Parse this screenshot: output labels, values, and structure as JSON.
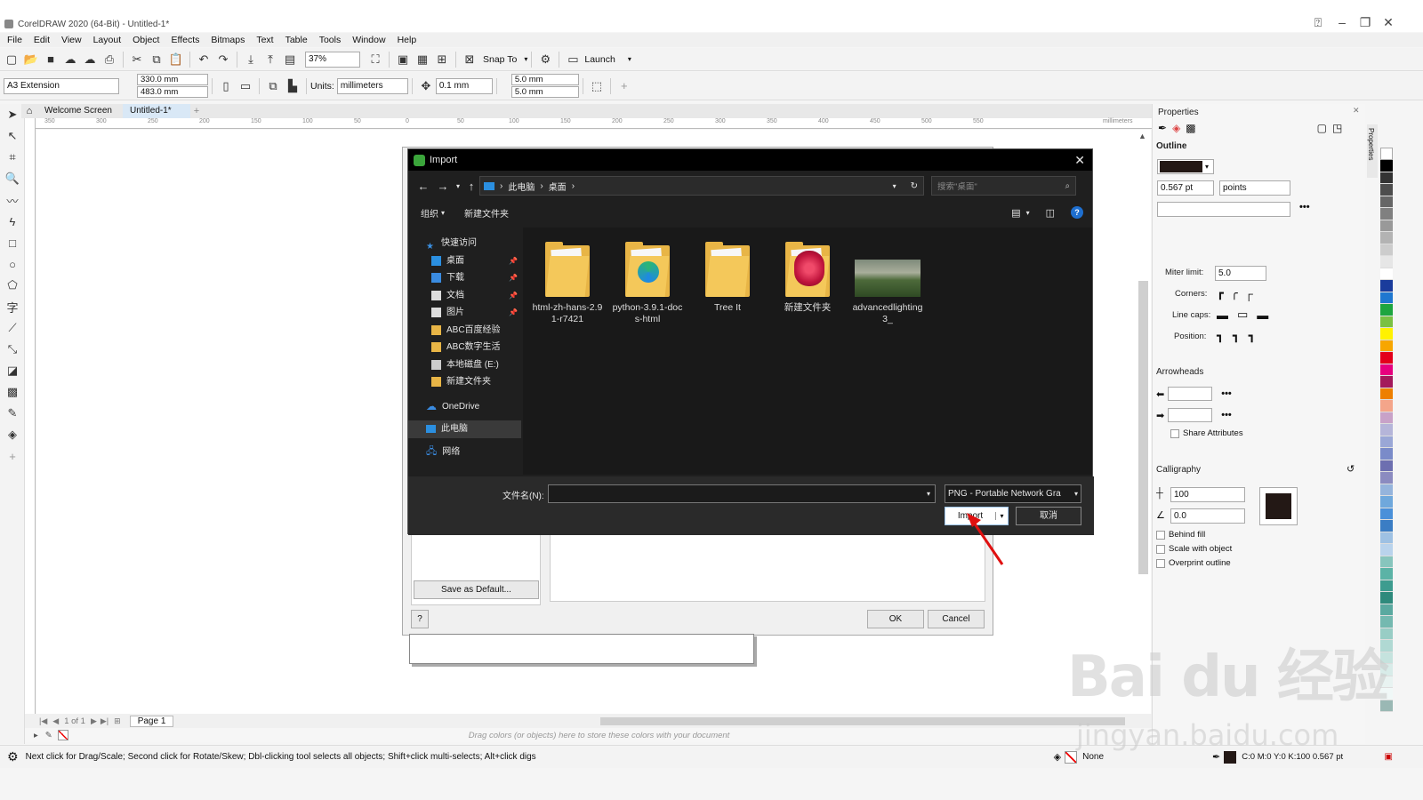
{
  "window": {
    "title": "CorelDRAW 2020 (64-Bit) - Untitled-1*"
  },
  "menu": [
    "File",
    "Edit",
    "View",
    "Layout",
    "Object",
    "Effects",
    "Bitmaps",
    "Text",
    "Table",
    "Tools",
    "Window",
    "Help"
  ],
  "toolbar1": {
    "zoom": "37%",
    "snap_to": "Snap To",
    "launch": "Launch"
  },
  "toolbar2": {
    "page_size": "A3 Extension",
    "width": "330.0 mm",
    "height": "483.0 mm",
    "units_label": "Units:",
    "units": "millimeters",
    "nudge": "0.1 mm",
    "dup_x": "5.0 mm",
    "dup_y": "5.0 mm"
  },
  "tabs": {
    "welcome": "Welcome Screen",
    "doc": "Untitled-1*"
  },
  "ruler": {
    "ticks": [
      "350",
      "300",
      "250",
      "200",
      "150",
      "100",
      "50",
      "0",
      "50",
      "100",
      "150",
      "200",
      "250",
      "300",
      "350",
      "400",
      "450",
      "500",
      "550"
    ],
    "unit": "millimeters"
  },
  "import_dialog": {
    "title": "Import",
    "breadcrumb": [
      "此电脑",
      "桌面"
    ],
    "search_placeholder": "搜索\"桌面\"",
    "organize": "组织",
    "new_folder": "新建文件夹",
    "tree": [
      {
        "label": "快速访问",
        "icon": "star-icon",
        "color": "#3b8fe0",
        "pin": false,
        "indent": 0
      },
      {
        "label": "桌面",
        "icon": "desktop-icon",
        "color": "#2b8fe0",
        "pin": true,
        "indent": 1
      },
      {
        "label": "下载",
        "icon": "download-icon",
        "color": "#3a8be0",
        "pin": true,
        "indent": 1
      },
      {
        "label": "文档",
        "icon": "document-icon",
        "color": "#dddddd",
        "pin": true,
        "indent": 1
      },
      {
        "label": "图片",
        "icon": "picture-icon",
        "color": "#dddddd",
        "pin": true,
        "indent": 1
      },
      {
        "label": "ABC百度经验",
        "icon": "folder-icon",
        "color": "#e8b546",
        "pin": false,
        "indent": 1
      },
      {
        "label": "ABC数字生活",
        "icon": "folder-icon",
        "color": "#e8b546",
        "pin": false,
        "indent": 1
      },
      {
        "label": "本地磁盘 (E:)",
        "icon": "drive-icon",
        "color": "#cccccc",
        "pin": false,
        "indent": 1
      },
      {
        "label": "新建文件夹",
        "icon": "folder-icon",
        "color": "#e8b546",
        "pin": false,
        "indent": 1
      }
    ],
    "onedrive": "OneDrive",
    "this_pc": "此电脑",
    "network": "网络",
    "files": [
      {
        "name": "html-zh-hans-2.91-r7421",
        "kind": "folder"
      },
      {
        "name": "python-3.9.1-docs-html",
        "kind": "folder-edge"
      },
      {
        "name": "Tree It",
        "kind": "folder"
      },
      {
        "name": "新建文件夹",
        "kind": "folder-flower"
      },
      {
        "name": "advancedlighting3_",
        "kind": "image"
      }
    ],
    "filename_label": "文件名(N):",
    "filename_value": "",
    "filetype": "PNG - Portable Network Gra",
    "import_btn": "Import",
    "cancel_btn": "取消"
  },
  "options_dialog": {
    "save_default": "Save as Default...",
    "help": "?",
    "ok": "OK",
    "cancel": "Cancel"
  },
  "properties": {
    "title": "Properties",
    "section": "Outline",
    "width_value": "0.567 pt",
    "width_unit": "points",
    "miter_label": "Miter limit:",
    "miter_value": "5.0",
    "corners_label": "Corners:",
    "linecaps_label": "Line caps:",
    "position_label": "Position:",
    "arrowheads": "Arrowheads",
    "share_attributes": "Share Attributes",
    "calligraphy": "Calligraphy",
    "stretch": "100",
    "angle": "0.0",
    "behind_fill": "Behind fill",
    "scale_with_object": "Scale with object",
    "overprint_outline": "Overprint outline",
    "side_tab": "Properties"
  },
  "palette": [
    "#000000",
    "#333333",
    "#4d4d4d",
    "#666666",
    "#808080",
    "#999999",
    "#b3b3b3",
    "#cccccc",
    "#e6e6e6",
    "#ffffff",
    "#1a3c9c",
    "#1f77d0",
    "#1da53f",
    "#7ac143",
    "#fff200",
    "#f7a600",
    "#e3001b",
    "#e6007e",
    "#a3195b",
    "#ee7f00",
    "#f4a58a",
    "#c8a2c8",
    "#b5b5d9",
    "#9aa7d6",
    "#7a8bc9",
    "#6d6fb0",
    "#8b8bc0",
    "#95b4dc",
    "#6fa8dc",
    "#4a90d9",
    "#3b7dc4",
    "#9ec1e3",
    "#b9d3ec",
    "#87c5bd",
    "#5bb3a6",
    "#3d9c8f",
    "#2e8a7c",
    "#5aa9a0",
    "#74b9b0",
    "#98cdc5",
    "#b0d9d3",
    "#c5e3de",
    "#d8ece9",
    "#e8f3f1",
    "#f0f8f7",
    "#9ab8b4"
  ],
  "docbar": {
    "page_info": "1 of 1",
    "page_tab": "Page 1"
  },
  "dropbar": {
    "hint": "Drag colors (or objects) here to store these colors with your document"
  },
  "status": {
    "hint": "Next click for Drag/Scale; Second click for Rotate/Skew; Dbl-clicking tool selects all objects; Shift+click multi-selects; Alt+click digs",
    "fill": "None",
    "outline": "C:0 M:0 Y:0 K:100  0.567 pt"
  },
  "watermark": {
    "main": "Bai du 经验",
    "sub": "jingyan.baidu.com"
  }
}
